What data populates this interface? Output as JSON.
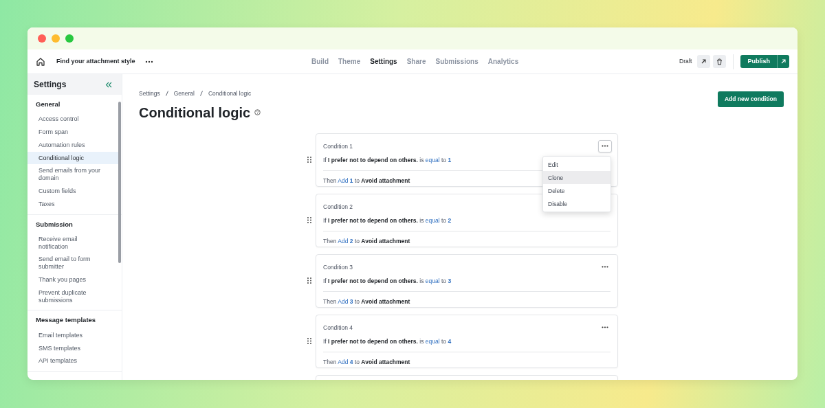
{
  "topbar": {
    "form_title": "Find your attachment style",
    "tabs": [
      {
        "label": "Build",
        "selected": false
      },
      {
        "label": "Theme",
        "selected": false
      },
      {
        "label": "Settings",
        "selected": true
      },
      {
        "label": "Share",
        "selected": false
      },
      {
        "label": "Submissions",
        "selected": false
      },
      {
        "label": "Analytics",
        "selected": false
      }
    ],
    "status": "Draft",
    "publish_button": "Publish"
  },
  "sidebar": {
    "title": "Settings",
    "groups": [
      {
        "heading": "General",
        "items": [
          {
            "label": "Access control",
            "selected": false
          },
          {
            "label": "Form span",
            "selected": false
          },
          {
            "label": "Automation rules",
            "selected": false
          },
          {
            "label": "Conditional logic",
            "selected": true
          },
          {
            "label": "Send emails from your domain",
            "selected": false
          },
          {
            "label": "Custom fields",
            "selected": false
          },
          {
            "label": "Taxes",
            "selected": false
          }
        ]
      },
      {
        "heading": "Submission",
        "items": [
          {
            "label": "Receive email notification",
            "selected": false
          },
          {
            "label": "Send email to form submitter",
            "selected": false
          },
          {
            "label": "Thank you pages",
            "selected": false
          },
          {
            "label": "Prevent duplicate submissions",
            "selected": false
          }
        ]
      },
      {
        "heading": "Message templates",
        "items": [
          {
            "label": "Email templates",
            "selected": false
          },
          {
            "label": "SMS templates",
            "selected": false
          },
          {
            "label": "API templates",
            "selected": false
          }
        ]
      }
    ]
  },
  "breadcrumb": [
    "Settings",
    "General",
    "Conditional logic"
  ],
  "page_title": "Conditional logic",
  "add_button": "Add new condition",
  "conditions": [
    {
      "title": "Condition 1",
      "menu_open": true,
      "rule": [
        {
          "kind": "plain",
          "text": "If"
        },
        {
          "kind": "field",
          "text": "I prefer not to depend on others."
        },
        {
          "kind": "plain",
          "text": "is"
        },
        {
          "kind": "op",
          "text": "equal"
        },
        {
          "kind": "plain",
          "text": "to"
        },
        {
          "kind": "value",
          "text": "1"
        }
      ],
      "action": [
        {
          "kind": "plain",
          "text": "Then"
        },
        {
          "kind": "op",
          "text": "Add"
        },
        {
          "kind": "value",
          "text": "1"
        },
        {
          "kind": "plain",
          "text": "to"
        },
        {
          "kind": "field",
          "text": "Avoid attachment"
        }
      ]
    },
    {
      "title": "Condition 2",
      "menu_open": false,
      "rule": [
        {
          "kind": "plain",
          "text": "If"
        },
        {
          "kind": "field",
          "text": "I prefer not to depend on others."
        },
        {
          "kind": "plain",
          "text": "is"
        },
        {
          "kind": "op",
          "text": "equal"
        },
        {
          "kind": "plain",
          "text": "to"
        },
        {
          "kind": "value",
          "text": "2"
        }
      ],
      "action": [
        {
          "kind": "plain",
          "text": "Then"
        },
        {
          "kind": "op",
          "text": "Add"
        },
        {
          "kind": "value",
          "text": "2"
        },
        {
          "kind": "plain",
          "text": "to"
        },
        {
          "kind": "field",
          "text": "Avoid attachment"
        }
      ]
    },
    {
      "title": "Condition 3",
      "menu_open": false,
      "rule": [
        {
          "kind": "plain",
          "text": "If"
        },
        {
          "kind": "field",
          "text": "I prefer not to depend on others."
        },
        {
          "kind": "plain",
          "text": "is"
        },
        {
          "kind": "op",
          "text": "equal"
        },
        {
          "kind": "plain",
          "text": "to"
        },
        {
          "kind": "value",
          "text": "3"
        }
      ],
      "action": [
        {
          "kind": "plain",
          "text": "Then"
        },
        {
          "kind": "op",
          "text": "Add"
        },
        {
          "kind": "value",
          "text": "3"
        },
        {
          "kind": "plain",
          "text": "to"
        },
        {
          "kind": "field",
          "text": "Avoid attachment"
        }
      ]
    },
    {
      "title": "Condition 4",
      "menu_open": false,
      "rule": [
        {
          "kind": "plain",
          "text": "If"
        },
        {
          "kind": "field",
          "text": "I prefer not to depend on others."
        },
        {
          "kind": "plain",
          "text": "is"
        },
        {
          "kind": "op",
          "text": "equal"
        },
        {
          "kind": "plain",
          "text": "to"
        },
        {
          "kind": "value",
          "text": "4"
        }
      ],
      "action": [
        {
          "kind": "plain",
          "text": "Then"
        },
        {
          "kind": "op",
          "text": "Add"
        },
        {
          "kind": "value",
          "text": "4"
        },
        {
          "kind": "plain",
          "text": "to"
        },
        {
          "kind": "field",
          "text": "Avoid attachment"
        }
      ]
    }
  ],
  "condition_menu": [
    {
      "label": "Edit",
      "selected": false
    },
    {
      "label": "Clone",
      "selected": true
    },
    {
      "label": "Delete",
      "selected": false
    },
    {
      "label": "Disable",
      "selected": false
    }
  ]
}
